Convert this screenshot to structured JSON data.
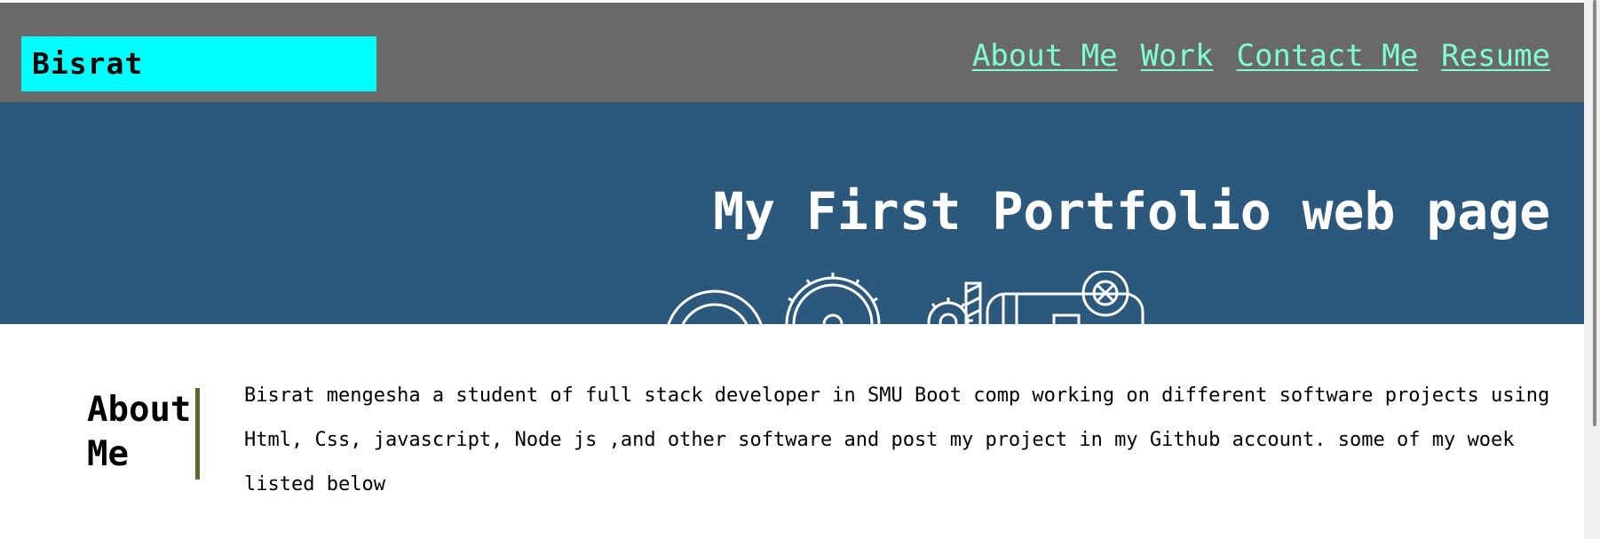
{
  "header": {
    "logo": "Bisrat",
    "nav": [
      {
        "label": "About Me"
      },
      {
        "label": "Work"
      },
      {
        "label": "Contact Me"
      },
      {
        "label": "Resume"
      }
    ]
  },
  "hero": {
    "title": "My First Portfolio web page"
  },
  "about": {
    "heading": "About Me",
    "text": "Bisrat mengesha a student of full stack developer in SMU Boot comp working on different software projects using Html, Css, javascript, Node js ,and other software and post my project in my Github account. some of my woek listed below"
  },
  "colors": {
    "header_bg": "#696969",
    "logo_bg": "#00ffff",
    "nav_link": "#7fffd4",
    "hero_bg": "#2c587b",
    "divider": "#556b2f"
  },
  "icons": [
    "gear-outline-icon",
    "machine-outline-icon"
  ]
}
